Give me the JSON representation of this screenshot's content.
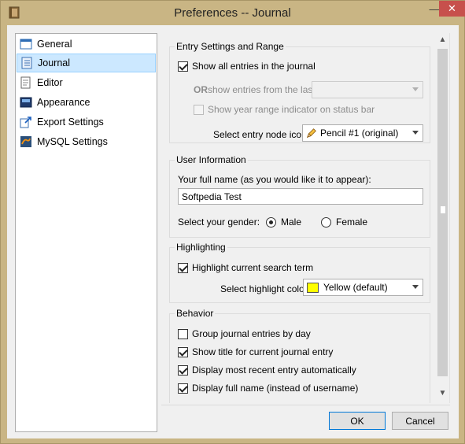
{
  "window": {
    "title": "Preferences -- Journal"
  },
  "nav": {
    "items": [
      {
        "label": "General",
        "icon": "window-icon",
        "selected": false
      },
      {
        "label": "Journal",
        "icon": "journal-icon",
        "selected": true
      },
      {
        "label": "Editor",
        "icon": "editor-icon",
        "selected": false
      },
      {
        "label": "Appearance",
        "icon": "appearance-icon",
        "selected": false
      },
      {
        "label": "Export Settings",
        "icon": "export-icon",
        "selected": false
      },
      {
        "label": "MySQL Settings",
        "icon": "mysql-icon",
        "selected": false
      }
    ]
  },
  "entry_settings": {
    "title": "Entry Settings and Range",
    "show_all_label": "Show all entries in the journal",
    "show_all_checked": true,
    "or_label_bold": "OR",
    "or_label_rest": " show entries from the last",
    "last_range_value": "",
    "year_range_label": "Show year range indicator on status bar",
    "year_range_checked": false,
    "node_icon_label": "Select entry node icon",
    "node_icon_value": "Pencil #1 (original)"
  },
  "user_info": {
    "title": "User Information",
    "name_label": "Your full name (as you would like it to appear):",
    "name_value": "Softpedia Test",
    "gender_label": "Select your gender:",
    "male_label": "Male",
    "female_label": "Female",
    "gender_selected": "Male"
  },
  "highlighting": {
    "title": "Highlighting",
    "highlight_label": "Highlight current search term",
    "highlight_checked": true,
    "color_label": "Select highlight color",
    "color_value": "Yellow (default)",
    "color_swatch": "#ffff00"
  },
  "behavior": {
    "title": "Behavior",
    "items": [
      {
        "label": "Group journal entries by day",
        "checked": false
      },
      {
        "label": "Show title for current journal entry",
        "checked": true
      },
      {
        "label": "Display most recent entry automatically",
        "checked": true
      },
      {
        "label": "Display full name (instead of username)",
        "checked": true
      }
    ]
  },
  "buttons": {
    "ok": "OK",
    "cancel": "Cancel"
  },
  "colors": {
    "frame": "#c9b584",
    "close_button": "#c7504c",
    "selection": "#cce8ff",
    "default_button_border": "#0078d7"
  }
}
